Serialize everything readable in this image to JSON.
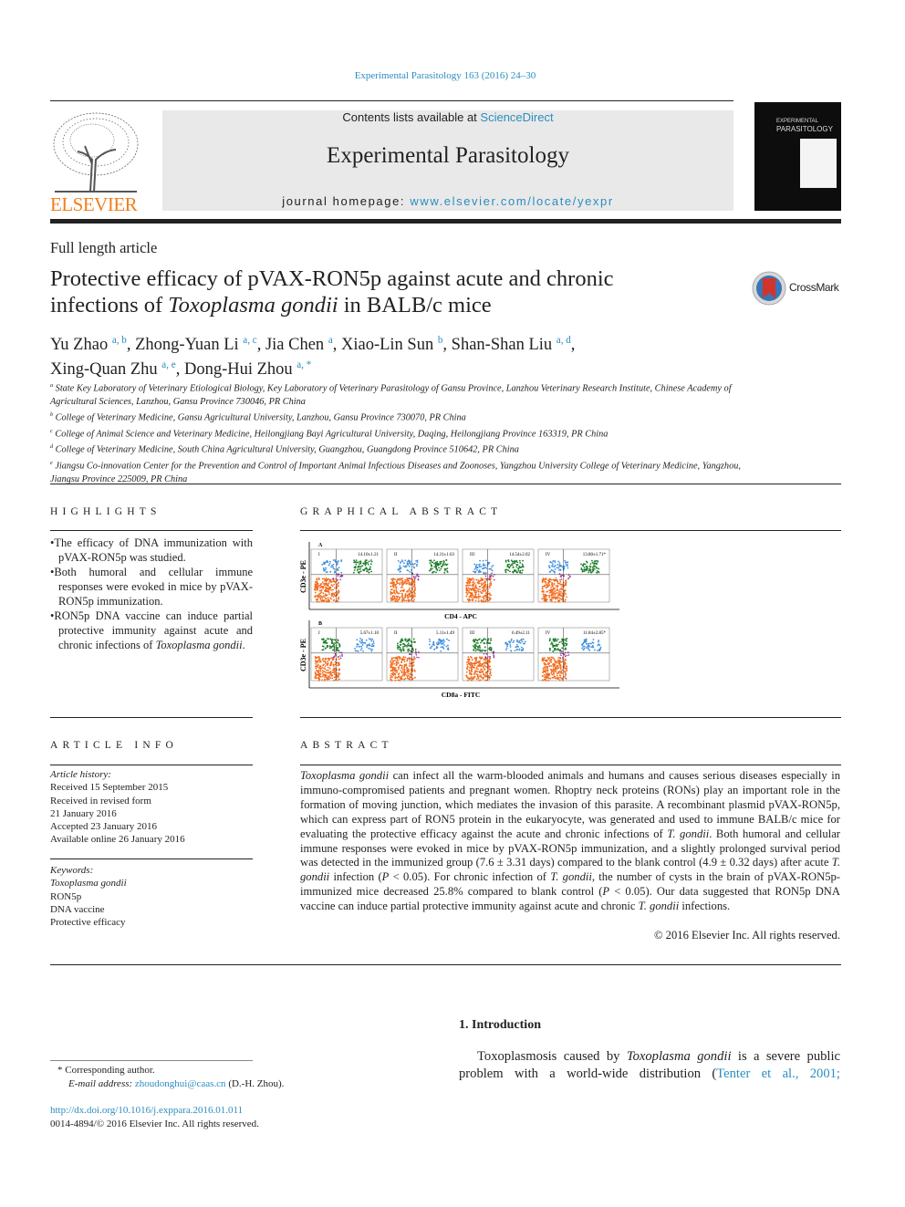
{
  "journal_ref": "Experimental Parasitology 163 (2016) 24–30",
  "header": {
    "contents_prefix": "Contents lists available at ",
    "sciencedirect": "ScienceDirect",
    "journal_name": "Experimental Parasitology",
    "homepage_prefix": "journal homepage: ",
    "homepage_url": "www.elsevier.com/locate/yexpr",
    "publisher_logo": "ELSEVIER",
    "cover_title_1": "EXPERIMENTAL",
    "cover_title_2": "PARASITOLOGY"
  },
  "article_type": "Full length article",
  "title": {
    "part1": "Protective efficacy of pVAX-RON5p against acute and chronic",
    "part2_pre": "infections of ",
    "part2_italic": "Toxoplasma gondii",
    "part2_post": " in BALB/c mice"
  },
  "crossmark": "CrossMark",
  "authors": [
    {
      "name": "Yu Zhao",
      "sup": "a, b",
      "sep": ", "
    },
    {
      "name": "Zhong-Yuan Li",
      "sup": "a, c",
      "sep": ", "
    },
    {
      "name": "Jia Chen",
      "sup": "a",
      "sep": ", "
    },
    {
      "name": "Xiao-Lin Sun",
      "sup": "b",
      "sep": ", "
    },
    {
      "name": "Shan-Shan Liu",
      "sup": "a, d",
      "sep": ","
    },
    {
      "name": "Xing-Quan Zhu",
      "sup": "a, e",
      "sep": ", "
    },
    {
      "name": "Dong-Hui Zhou",
      "sup": "a, *",
      "sep": ""
    }
  ],
  "affiliations": [
    {
      "key": "a",
      "text": "State Key Laboratory of Veterinary Etiological Biology, Key Laboratory of Veterinary Parasitology of Gansu Province, Lanzhou Veterinary Research Institute, Chinese Academy of Agricultural Sciences, Lanzhou, Gansu Province 730046, PR China"
    },
    {
      "key": "b",
      "text": "College of Veterinary Medicine, Gansu Agricultural University, Lanzhou, Gansu Province 730070, PR China"
    },
    {
      "key": "c",
      "text": "College of Animal Science and Veterinary Medicine, Heilongjiang Bayi Agricultural University, Daqing, Heilongjiang Province 163319, PR China"
    },
    {
      "key": "d",
      "text": "College of Veterinary Medicine, South China Agricultural University, Guangzhou, Guangdong Province 510642, PR China"
    },
    {
      "key": "e",
      "text": "Jiangsu Co-innovation Center for the Prevention and Control of Important Animal Infectious Diseases and Zoonoses, Yangzhou University College of Veterinary Medicine, Yangzhou, Jiangsu Province 225009, PR China"
    }
  ],
  "highlights": {
    "heading": "HIGHLIGHTS",
    "items": [
      "The efficacy of DNA immunization with pVAX-RON5p was studied.",
      "Both humoral and cellular immune responses were evoked in mice by pVAX-RON5p immunization.",
      "RON5p DNA vaccine can induce partial protective immunity against acute and chronic infections of "
    ],
    "item3_italic": "Toxoplasma gondii",
    "item3_end": "."
  },
  "graphical_abstract": {
    "heading": "GRAPHICAL ABSTRACT",
    "ylabel": "CD3e - PE",
    "rows": [
      {
        "label": "A",
        "xlabel": "CD4 - APC",
        "panels": [
          {
            "group": "I",
            "value": "14.10±1.21"
          },
          {
            "group": "II",
            "value": "14.31±1.63"
          },
          {
            "group": "III",
            "value": "14.54±2.02"
          },
          {
            "group": "IV",
            "value": "13.80±1.71*"
          }
        ]
      },
      {
        "label": "B",
        "xlabel": "CD8a - FITC",
        "panels": [
          {
            "group": "I",
            "value": "5.67±1.10"
          },
          {
            "group": "II",
            "value": "5.11±1.49"
          },
          {
            "group": "III",
            "value": "6.49±2.11"
          },
          {
            "group": "IV",
            "value": "11.84±2.85*"
          }
        ]
      }
    ],
    "colors": {
      "q1": "#3d8fe0",
      "q2": "#1e7d2a",
      "q3": "#f26b1d",
      "q4": "#9b2f9b"
    }
  },
  "article_info": {
    "heading": "ARTICLE INFO",
    "history_label": "Article history:",
    "history": [
      "Received 15 September 2015",
      "Received in revised form",
      "21 January 2016",
      "Accepted 23 January 2016",
      "Available online 26 January 2016"
    ],
    "keywords_label": "Keywords:",
    "keywords": [
      "Toxoplasma gondii",
      "RON5p",
      "DNA vaccine",
      "Protective efficacy"
    ]
  },
  "abstract": {
    "heading": "ABSTRACT",
    "text_html": "<i>Toxoplasma gondii</i> can infect all the warm-blooded animals and humans and causes serious diseases especially in immuno-compromised patients and pregnant women. Rhoptry neck proteins (RONs) play an important role in the formation of moving junction, which mediates the invasion of this parasite. A recombinant plasmid pVAX-RON5p, which can express part of RON5 protein in the eukaryocyte, was generated and used to immune BALB/c mice for evaluating the protective efficacy against the acute and chronic infections of <i>T. gondii</i>. Both humoral and cellular immune responses were evoked in mice by pVAX-RON5p immunization, and a slightly prolonged survival period was detected in the immunized group (7.6 ± 3.31 days) compared to the blank control (4.9 ± 0.32 days) after acute <i>T. gondii</i> infection (<i>P</i> &lt; 0.05). For chronic infection of <i>T. gondii</i>, the number of cysts in the brain of pVAX-RON5p-immunized mice decreased 25.8% compared to blank control (<i>P</i> &lt; 0.05). Our data suggested that RON5p DNA vaccine can induce partial protective immunity against acute and chronic <i>T. gondii</i> infections.",
    "copyright": "© 2016 Elsevier Inc. All rights reserved."
  },
  "introduction": {
    "heading": "1.  Introduction",
    "text_pre": "Toxoplasmosis caused by ",
    "text_italic": "Toxoplasma gondii",
    "text_mid": " is a severe public problem with a world-wide distribution (",
    "citation": "Tenter et al., 2001;"
  },
  "footnotes": {
    "corresponding": "* Corresponding author.",
    "email_label": "E-mail address: ",
    "email": "zhoudonghui@caas.cn",
    "email_suffix": " (D.-H. Zhou).",
    "doi": "http://dx.doi.org/10.1016/j.exppara.2016.01.011",
    "issn": "0014-4894/© 2016 Elsevier Inc. All rights reserved."
  }
}
